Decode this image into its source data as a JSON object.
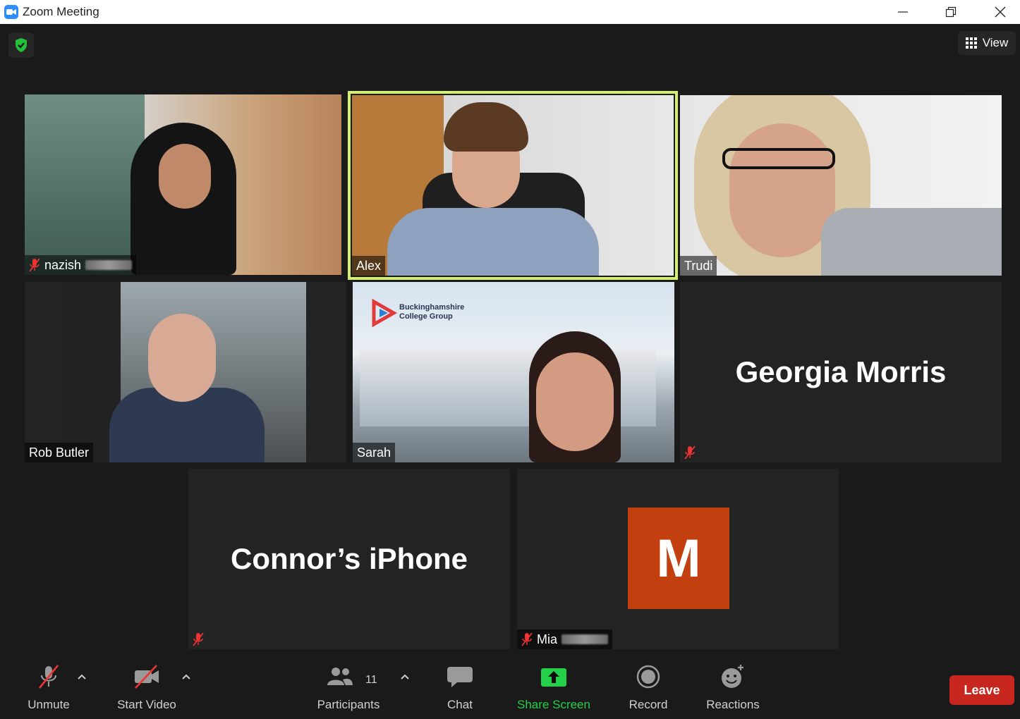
{
  "window": {
    "title": "Zoom Meeting"
  },
  "header": {
    "view_label": "View"
  },
  "participants": {
    "nazish": "nazish",
    "alex": "Alex",
    "trudi": "Trudi",
    "rob": "Rob Butler",
    "sarah": "Sarah",
    "georgia": "Georgia Morris",
    "connor": "Connor’s iPhone",
    "mia": "Mia",
    "mia_initial": "M"
  },
  "sarah_background_logo": "Buckinghamshire College Group",
  "toolbar": {
    "unmute": "Unmute",
    "start_video": "Start Video",
    "participants": "Participants",
    "participant_count": "11",
    "chat": "Chat",
    "share_screen": "Share Screen",
    "record": "Record",
    "reactions": "Reactions",
    "leave": "Leave"
  },
  "colors": {
    "active_speaker": "#d4ef6a",
    "share_green": "#24d04a",
    "leave_red": "#c8271f",
    "avatar_orange": "#c2400f",
    "zoom_blue": "#2d8cff"
  }
}
